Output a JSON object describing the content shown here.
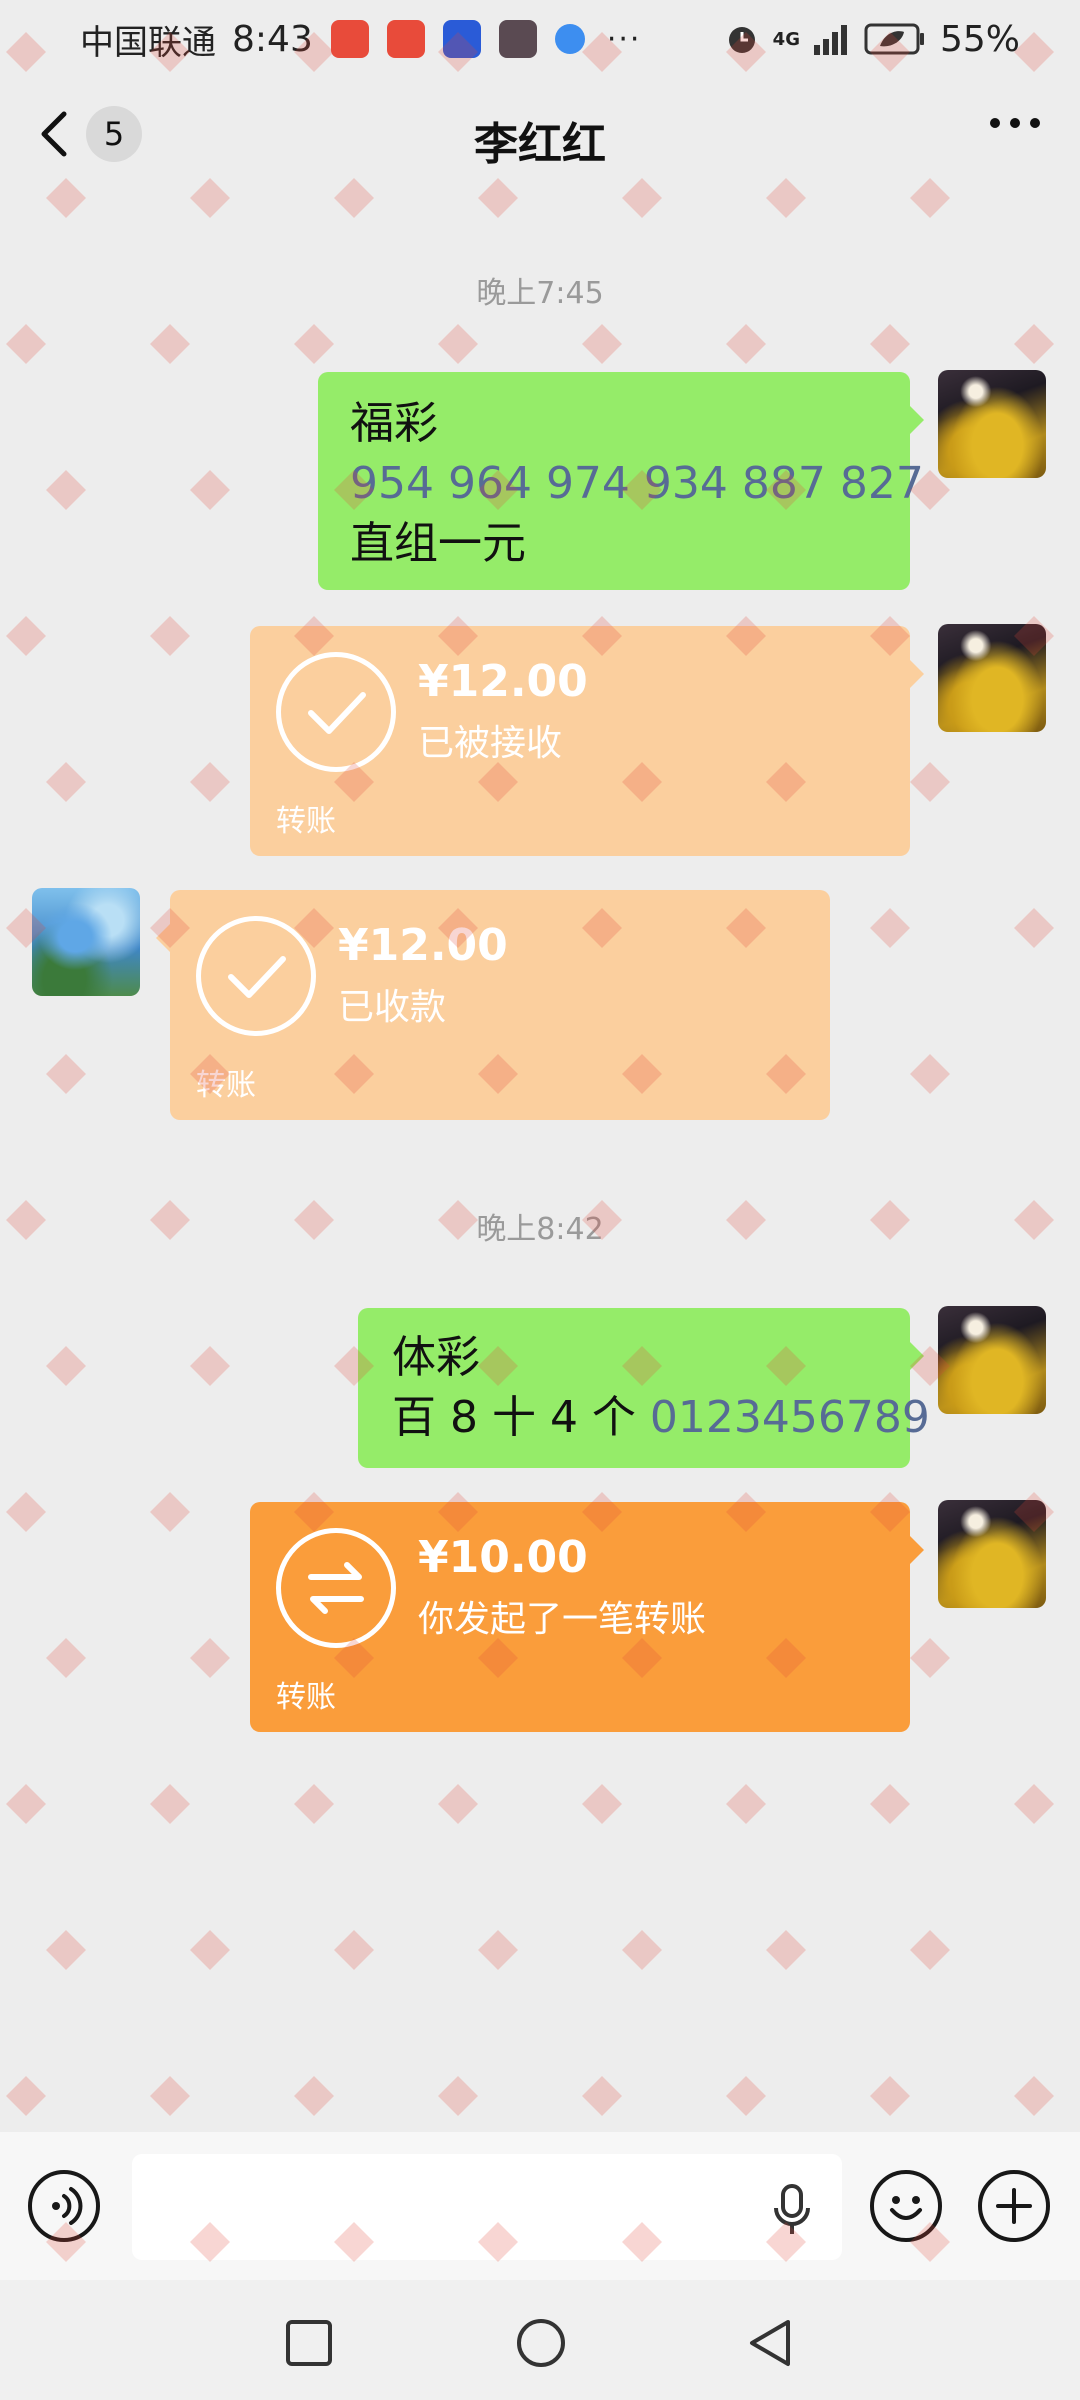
{
  "status_bar": {
    "carrier": "中国联通",
    "time": "8:43",
    "more": "···",
    "network": "4G",
    "battery": "55%"
  },
  "nav": {
    "unread_count": "5",
    "title": "李红红"
  },
  "messages": {
    "ts1": "晚上7:45",
    "msg1": {
      "line1": "福彩",
      "line2": "954 964 974 934 887 827",
      "line3": "直组一元"
    },
    "transfer1": {
      "amount": "¥12.00",
      "status": "已被接收",
      "label": "转账"
    },
    "transfer2": {
      "amount": "¥12.00",
      "status": "已收款",
      "label": "转账"
    },
    "ts2": "晚上8:42",
    "msg2": {
      "line1": "体彩",
      "line2_prefix": "百 8 十 4 个 ",
      "line2_link": "0123456789"
    },
    "transfer3": {
      "amount": "¥10.00",
      "status": "你发起了一笔转账",
      "label": "转账"
    }
  },
  "colors": {
    "chat_bg": "#ededed",
    "bubble_green": "#95ec69",
    "transfer_done": "#fbcf9e",
    "transfer_active": "#fa9d3b",
    "link": "#576b95"
  },
  "icons": {
    "back": "chevron-left-icon",
    "more": "more-icon",
    "voice": "voice-icon",
    "mic": "mic-icon",
    "emoji": "emoji-icon",
    "plus": "plus-icon",
    "check": "check-icon",
    "transfer": "transfer-arrows-icon",
    "recent": "square-icon",
    "home": "circle-icon",
    "back_sys": "triangle-back-icon"
  }
}
